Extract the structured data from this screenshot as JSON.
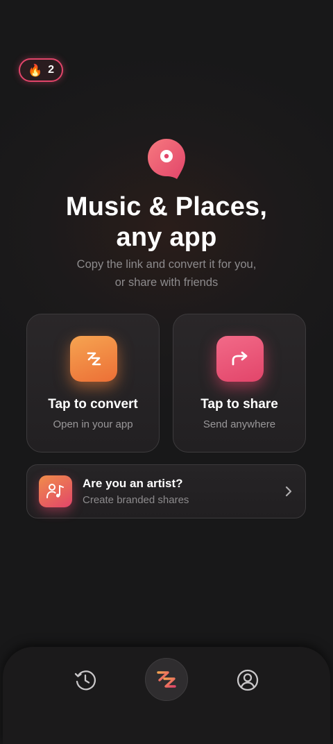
{
  "streak": {
    "icon": "flame-icon",
    "count": "2"
  },
  "hero": {
    "title_line1": "Music & Places,",
    "title_line2": "any app",
    "subtitle_line1": "Copy the link and convert it for you,",
    "subtitle_line2": "or share with friends"
  },
  "cards": {
    "convert": {
      "icon": "convert-z-icon",
      "title": "Tap to convert",
      "subtitle": "Open in your app"
    },
    "share": {
      "icon": "share-arrow-icon",
      "title": "Tap to share",
      "subtitle": "Send anywhere"
    }
  },
  "artist": {
    "icon": "artist-music-icon",
    "title": "Are you an artist?",
    "subtitle": "Create branded shares"
  },
  "tabbar": {
    "history_icon": "history-icon",
    "home_icon": "app-logo-icon",
    "profile_icon": "profile-icon"
  },
  "colors": {
    "accent_pink": "#e2456a",
    "accent_orange": "#f0883e",
    "background": "#1c1a1b"
  }
}
